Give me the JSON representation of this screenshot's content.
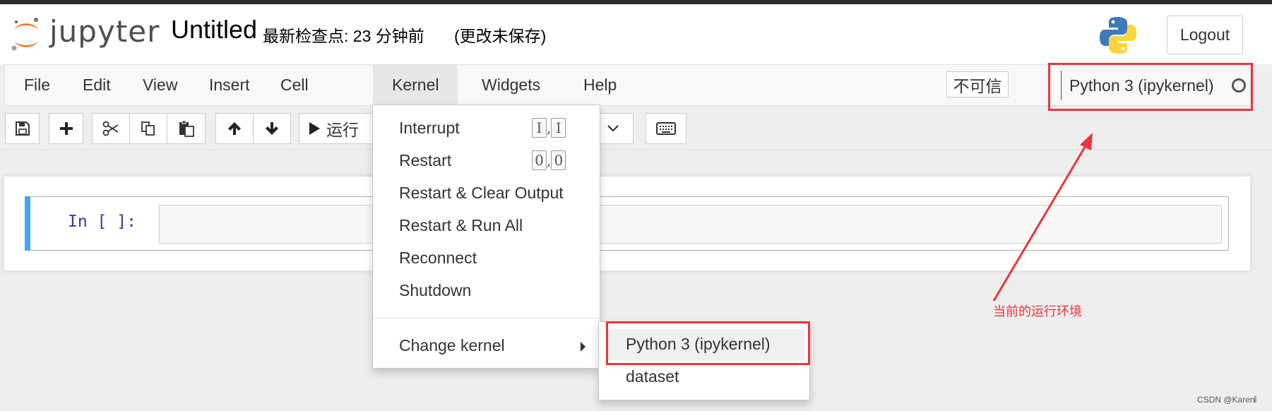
{
  "header": {
    "logo_text": "jupyter",
    "notebook_title": "Untitled",
    "checkpoint_status": "最新检查点: 23 分钟前",
    "unsaved_status": "(更改未保存)",
    "logout_label": "Logout"
  },
  "menubar": {
    "items": [
      {
        "label": "File"
      },
      {
        "label": "Edit"
      },
      {
        "label": "View"
      },
      {
        "label": "Insert"
      },
      {
        "label": "Cell"
      },
      {
        "label": "Kernel",
        "active": true
      },
      {
        "label": "Widgets"
      },
      {
        "label": "Help"
      }
    ],
    "trust_label": "不可信",
    "kernel_name": "Python 3 (ipykernel)"
  },
  "toolbar": {
    "run_label": "运行"
  },
  "cell": {
    "prompt": "In [ ]:"
  },
  "kernel_menu": {
    "items": [
      {
        "label": "Interrupt",
        "shortcut_key": "I"
      },
      {
        "label": "Restart",
        "shortcut_key": "0"
      },
      {
        "label": "Restart & Clear Output"
      },
      {
        "label": "Restart & Run All"
      },
      {
        "label": "Reconnect"
      },
      {
        "label": "Shutdown"
      }
    ],
    "change_kernel_label": "Change kernel",
    "submenu": [
      {
        "label": "Python 3 (ipykernel)",
        "highlighted": true
      },
      {
        "label": "dataset"
      }
    ]
  },
  "annotation": {
    "text": "当前的运行环境",
    "color": "#e8363c"
  },
  "watermark": "CSDN @Karen𝄃",
  "colors": {
    "jupyter_orange": "#f37726",
    "cell_selected_bar": "#42a5f5",
    "prompt_blue": "#303f9f",
    "highlight_red": "#e8363c"
  }
}
